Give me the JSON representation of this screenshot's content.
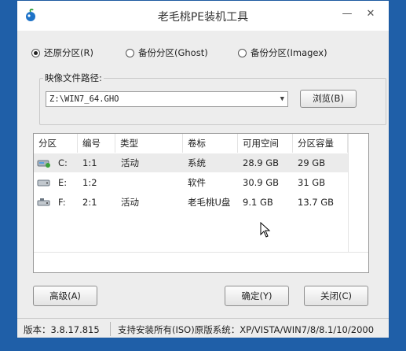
{
  "window": {
    "title": "老毛桃PE装机工具",
    "minimize_glyph": "—",
    "close_glyph": "✕"
  },
  "radios": [
    {
      "label": "还原分区(R)",
      "checked": true
    },
    {
      "label": "备份分区(Ghost)",
      "checked": false
    },
    {
      "label": "备份分区(Imagex)",
      "checked": false
    }
  ],
  "image_path": {
    "group_label": "映像文件路径:",
    "value": "Z:\\WIN7_64.GHO",
    "browse_label": "浏览(B)"
  },
  "table": {
    "columns": [
      "分区",
      "编号",
      "类型",
      "卷标",
      "可用空间",
      "分区容量"
    ],
    "rows": [
      {
        "partition": "C:",
        "number": "1:1",
        "type": "活动",
        "label": "系统",
        "free": "28.9 GB",
        "capacity": "29 GB",
        "icon": "system-drive-icon"
      },
      {
        "partition": "E:",
        "number": "1:2",
        "type": "",
        "label": "软件",
        "free": "30.9 GB",
        "capacity": "31 GB",
        "icon": "hard-drive-icon"
      },
      {
        "partition": "F:",
        "number": "2:1",
        "type": "活动",
        "label": "老毛桃U盘",
        "free": "9.1 GB",
        "capacity": "13.7 GB",
        "icon": "usb-drive-icon"
      }
    ]
  },
  "buttons": {
    "advanced": "高级(A)",
    "ok": "确定(Y)",
    "close": "关闭(C)"
  },
  "status": {
    "version": "版本：3.8.17.815",
    "support": "支持安装所有(ISO)原版系统：XP/VISTA/WIN7/8/8.1/10/2000"
  },
  "colors": {
    "desktop": "#1f5fa8",
    "window_bg": "#ededed",
    "selected_row": "#ebebeb"
  }
}
